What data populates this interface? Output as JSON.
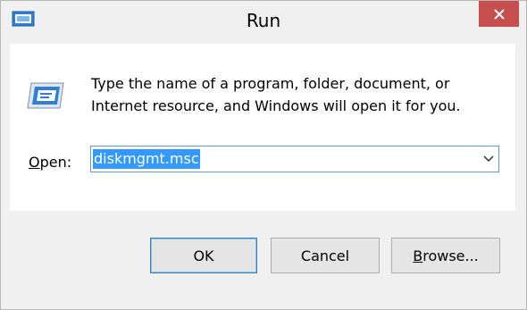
{
  "window": {
    "title": "Run",
    "app_icon": "run-dialog-icon",
    "close_icon": "close-icon"
  },
  "content": {
    "icon": "run-program-icon",
    "description": "Type the name of a program, folder, document, or Internet resource, and Windows will open it for you.",
    "open_label_accel": "O",
    "open_label_rest": "pen:",
    "combo_value": "diskmgmt.msc",
    "combo_arrow_icon": "chevron-down-icon"
  },
  "buttons": {
    "ok": "OK",
    "cancel": "Cancel",
    "browse_accel": "B",
    "browse_rest": "rowse..."
  },
  "colors": {
    "close_button": "#c7504e",
    "selection": "#3399ff",
    "focus_border": "#5b9bd5"
  }
}
